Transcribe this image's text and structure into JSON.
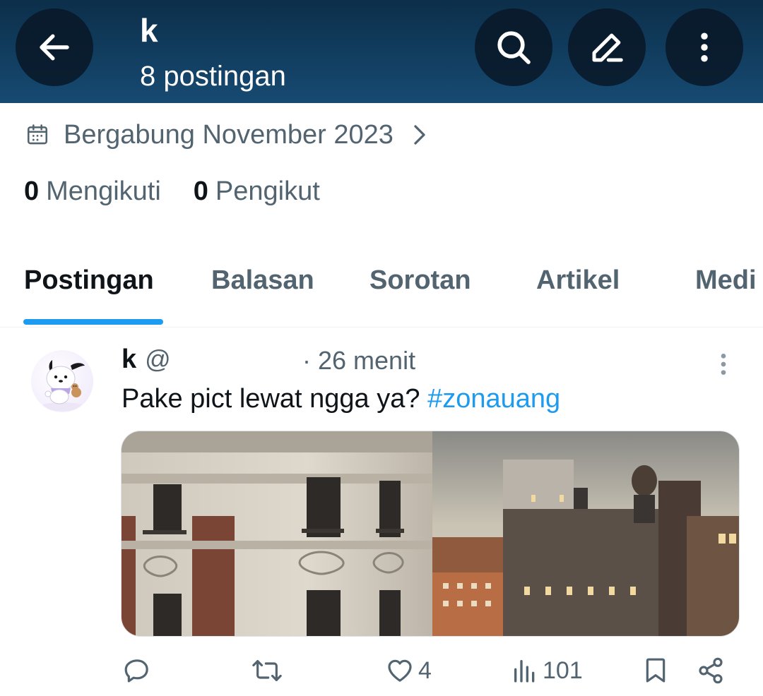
{
  "header": {
    "name": "k",
    "post_count": "8 postingan",
    "icons": [
      "back-arrow-icon",
      "search-icon",
      "edit-pencil-icon",
      "more-vertical-icon"
    ]
  },
  "profile": {
    "joined": "Bergabung November 2023",
    "following_count": "0",
    "following_label": "Mengikuti",
    "followers_count": "0",
    "followers_label": "Pengikut"
  },
  "tabs": [
    {
      "label": "Postingan",
      "active": true
    },
    {
      "label": "Balasan",
      "active": false
    },
    {
      "label": "Sorotan",
      "active": false
    },
    {
      "label": "Artikel",
      "active": false
    },
    {
      "label": "Medi",
      "active": false
    }
  ],
  "post": {
    "name": "k",
    "handle": "@",
    "time": "· 26 menit",
    "text": "Pake pict lewat ngga ya?",
    "hashtag": "#zonauang",
    "actions": {
      "reply_count": "",
      "repost_count": "",
      "like_count": "4",
      "views_count": "101"
    }
  },
  "colors": {
    "header_bg": "#123f62",
    "accent": "#1d9bf0",
    "secondary_text": "#536471",
    "primary_text": "#0f1419"
  }
}
